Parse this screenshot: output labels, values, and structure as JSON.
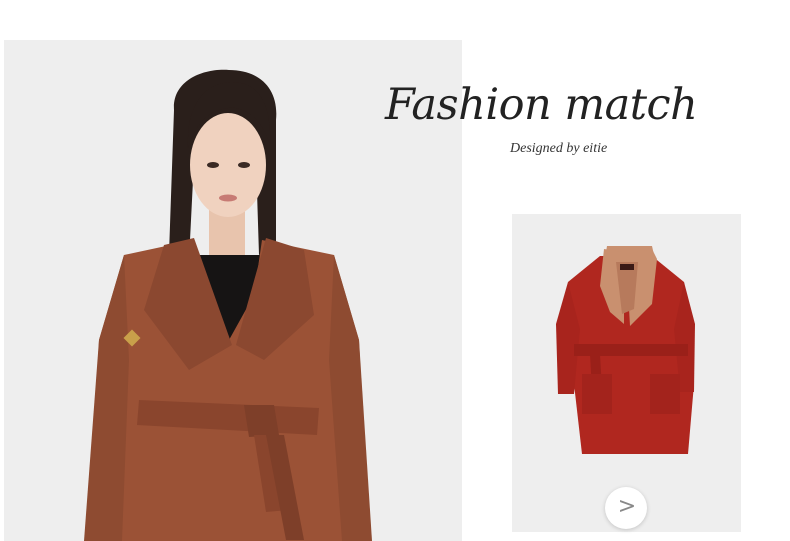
{
  "heading": {
    "title": "Fashion match",
    "subtitle": "Designed by eitie"
  },
  "model_image": {
    "alt": "Model wearing a belted wrap coat",
    "coat_color": "#9b5236",
    "background_color": "#eeeeee"
  },
  "product": {
    "alt": "Red wool coat with contrasting lapels",
    "coat_color": "#b0271f",
    "lapel_color": "#c9906f",
    "label_text": "EITIE"
  },
  "navigation": {
    "next_icon": "chevron-right-icon",
    "next_glyph": ">"
  }
}
